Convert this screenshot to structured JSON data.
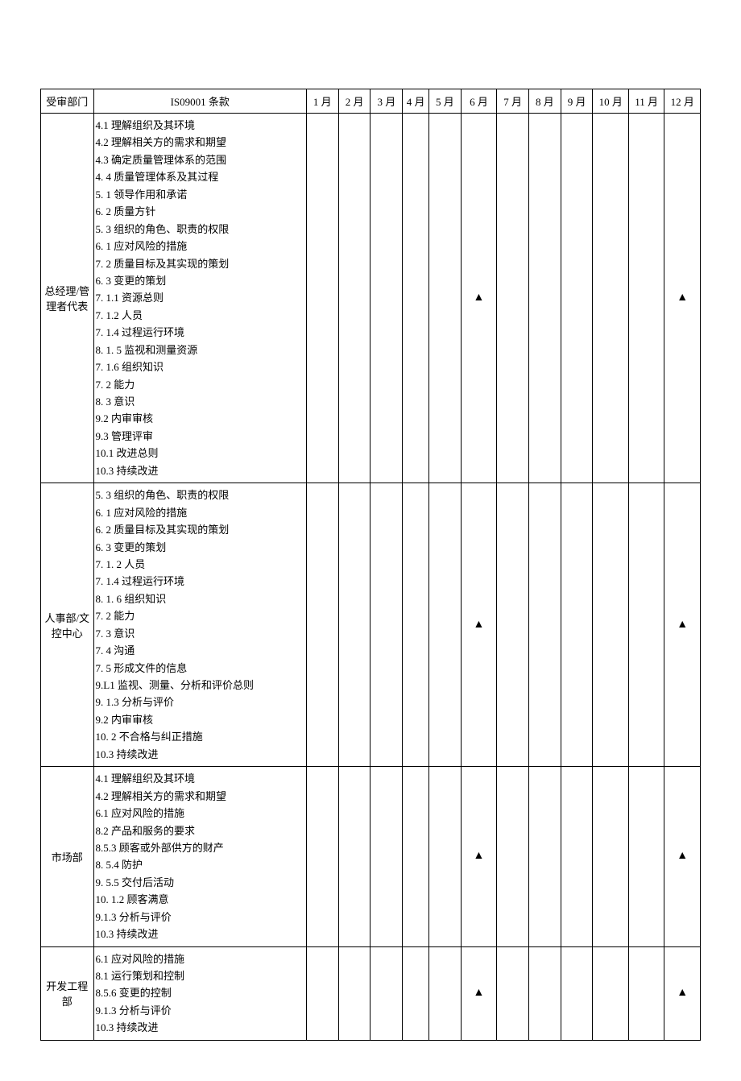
{
  "headers": {
    "department": "受审部门",
    "clause": "IS09001 条款",
    "months": [
      "1 月",
      "2 月",
      "3 月",
      "4 月",
      "5 月",
      "6 月",
      "7 月",
      "8 月",
      "9 月",
      "10 月",
      "11 月",
      "12 月"
    ]
  },
  "marker": "▲",
  "rows": [
    {
      "department": "总经理/管理者代表",
      "clauses": "4.1 理解组织及其环境\n4.2 理解相关方的需求和期望\n4.3 确定质量管理体系的范围\n4. 4 质量管理体系及其过程\n5. 1 领导作用和承诺\n6. 2 质量方针\n5. 3 组织的角色、职责的权限\n6. 1 应对风险的措施\n7. 2 质量目标及其实现的策划\n6. 3 变更的策划\n7. 1.1 资源总则\n7. 1.2 人员\n7. 1.4 过程运行环境\n8. 1. 5 监视和测量资源\n7. 1.6 组织知识\n7. 2 能力\n8. 3 意识\n9.2 内审审核\n9.3 管理评审\n10.1 改进总则\n10.3 持续改进",
      "marks": {
        "6": true,
        "12": true
      }
    },
    {
      "department": "人事部/文控中心",
      "clauses": "5. 3 组织的角色、职责的权限\n6. 1 应对风险的措施\n6. 2 质量目标及其实现的策划\n6. 3 变更的策划\n7. 1. 2 人员\n7. 1.4 过程运行环境\n8. 1. 6 组织知识\n7. 2 能力\n7. 3 意识\n7. 4 沟通\n7. 5 形成文件的信息\n9.L1 监视、测量、分析和评价总则\n9. 1.3 分析与评价\n9.2 内审审核\n10.        2 不合格与纠正措施\n10.3 持续改进",
      "marks": {
        "6": true,
        "12": true
      }
    },
    {
      "department": "市场部",
      "clauses": "4.1 理解组织及其环境\n4.2 理解相关方的需求和期望\n6.1 应对风险的措施\n8.2 产品和服务的要求\n8.5.3 顾客或外部供方的财产\n8. 5.4 防护\n9. 5.5 交付后活动\n10.        1.2 顾客满意\n9.1.3 分析与评价\n10.3 持续改进",
      "marks": {
        "6": true,
        "12": true
      }
    },
    {
      "department": "开发工程部",
      "clauses": "6.1 应对风险的措施\n8.1 运行策划和控制\n8.5.6 变更的控制\n9.1.3 分析与评价\n10.3 持续改进",
      "marks": {
        "6": true,
        "12": true
      }
    }
  ]
}
